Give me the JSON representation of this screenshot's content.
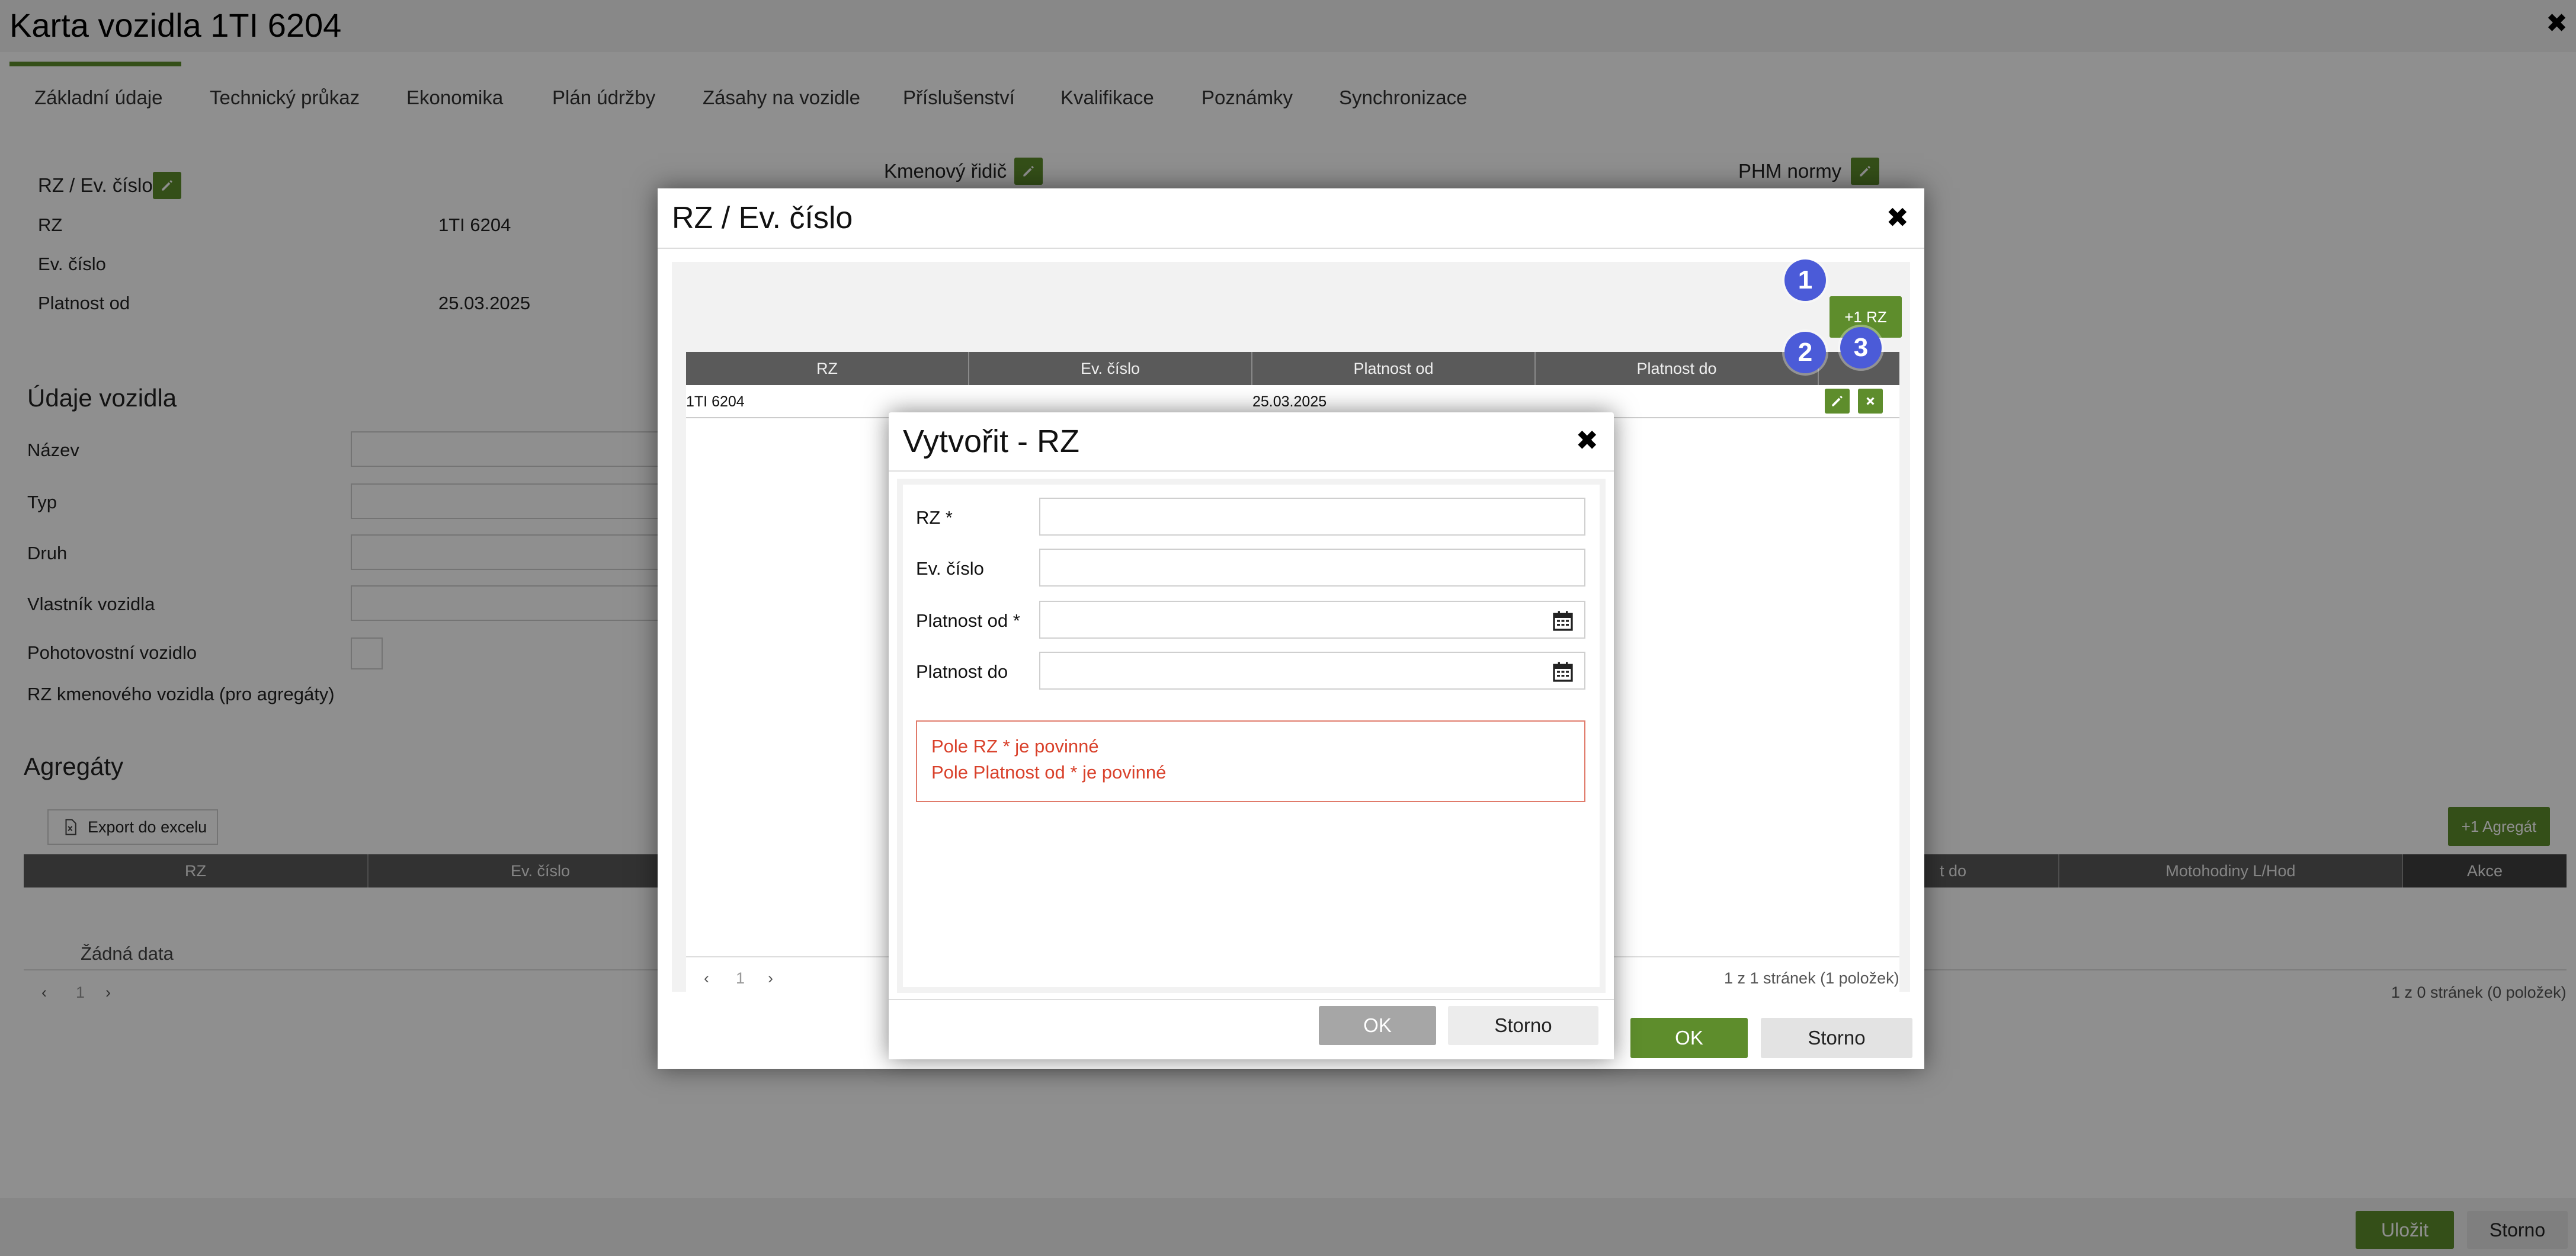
{
  "window": {
    "title": "Karta vozidla 1TI 6204",
    "close": "✖"
  },
  "tabs": [
    {
      "label": "Základní údaje",
      "active": true
    },
    {
      "label": "Technický průkaz"
    },
    {
      "label": "Ekonomika"
    },
    {
      "label": "Plán údržby"
    },
    {
      "label": "Zásahy na vozidle"
    },
    {
      "label": "Příslušenství"
    },
    {
      "label": "Kvalifikace"
    },
    {
      "label": "Poznámky"
    },
    {
      "label": "Synchronizace"
    }
  ],
  "rz_panel": {
    "title": "RZ / Ev. číslo",
    "rows": [
      {
        "label": "RZ",
        "value": "1TI 6204"
      },
      {
        "label": "Ev. číslo",
        "value": ""
      },
      {
        "label": "Platnost od",
        "value": "25.03.2025"
      }
    ]
  },
  "driver_panel": {
    "title": "Kmenový řidič"
  },
  "phm_panel": {
    "title": "PHM normy"
  },
  "vehicle_data": {
    "title": "Údaje vozidla",
    "fields": [
      "Název",
      "Typ",
      "Druh",
      "Vlastník vozidla"
    ],
    "standby_label": "Pohotovostní vozidlo",
    "parent_rz_label": "RZ kmenového vozidla (pro agregáty)"
  },
  "aggregates": {
    "title": "Agregáty",
    "export_label": "Export do excelu",
    "add_label": "+1 Agregát",
    "columns_left": [
      "RZ",
      "Ev. číslo"
    ],
    "columns_right": [
      "t do",
      "Motohodiny L/Hod",
      "Akce"
    ],
    "empty": "Žádná data",
    "pager_page": "1",
    "pager_info": "1 z 0 stránek (0 položek)"
  },
  "bottom": {
    "save": "Uložit",
    "cancel": "Storno"
  },
  "modal_rz": {
    "title": "RZ / Ev. číslo",
    "close": "✖",
    "add_label": "+1 RZ",
    "columns": [
      "RZ",
      "Ev. číslo",
      "Platnost od",
      "Platnost do"
    ],
    "rows": [
      {
        "rz": "1TI 6204",
        "ev": "",
        "from": "25.03.2025",
        "to": ""
      }
    ],
    "pager_page": "1",
    "pager_info": "1 z 1 stránek (1 položek)",
    "ok": "OK",
    "cancel": "Storno"
  },
  "modal_create": {
    "title": "Vytvořit - RZ",
    "close": "✖",
    "fields": [
      {
        "label": "RZ *",
        "value": ""
      },
      {
        "label": "Ev. číslo",
        "value": ""
      },
      {
        "label": "Platnost od *",
        "value": ""
      },
      {
        "label": "Platnost do",
        "value": ""
      }
    ],
    "errors": [
      "Pole RZ * je povinné",
      "Pole Platnost od * je povinné"
    ],
    "ok": "OK",
    "cancel": "Storno"
  },
  "badges": [
    "1",
    "2",
    "3"
  ],
  "colors": {
    "accent": "#5e8d2c",
    "badge": "#4b5bd8",
    "error": "#d9412b",
    "header": "#5a5a5a"
  }
}
